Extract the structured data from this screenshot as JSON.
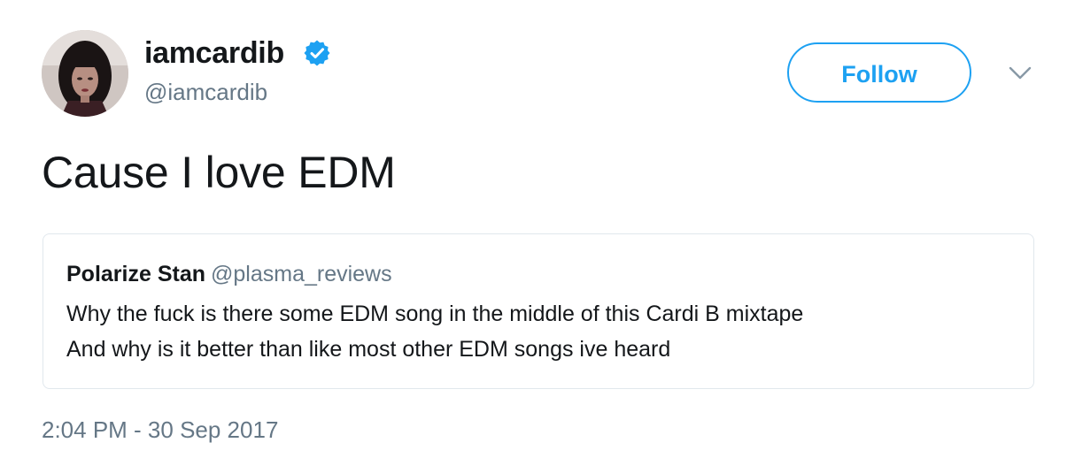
{
  "author": {
    "name": "iamcardib",
    "handle": "@iamcardib",
    "verified": true
  },
  "actions": {
    "follow_label": "Follow"
  },
  "tweet": {
    "text": "Cause I love EDM",
    "timestamp": "2:04 PM - 30 Sep 2017"
  },
  "quoted_tweet": {
    "name": "Polarize Stan",
    "handle": "@plasma_reviews",
    "lines": [
      "Why the fuck is there some EDM song in the middle of this Cardi B mixtape",
      "And why is it better than like most other EDM songs ive heard"
    ]
  },
  "icons": {
    "verified": "verified-badge-icon",
    "more": "chevron-down-icon"
  },
  "colors": {
    "accent": "#1da1f2",
    "text": "#14171a",
    "secondary_text": "#657786",
    "border": "#e1e8ed"
  }
}
